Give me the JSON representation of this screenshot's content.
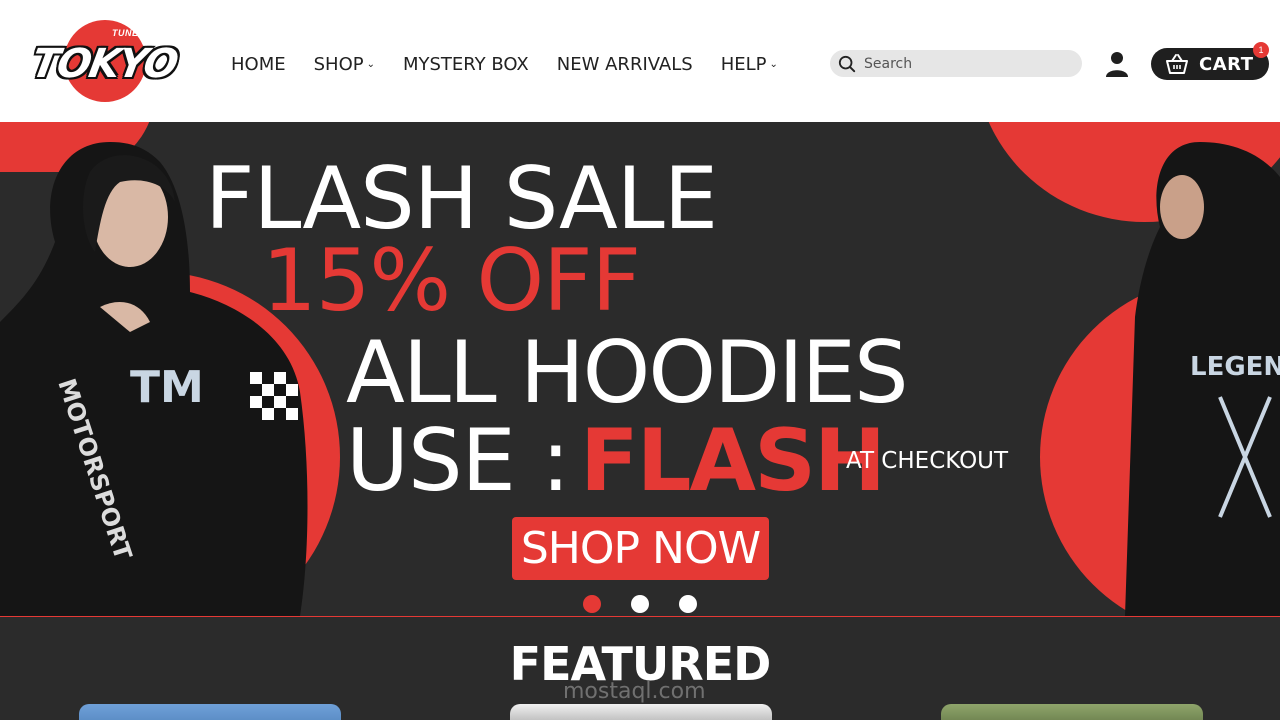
{
  "header": {
    "logo": {
      "text": "TOKYO",
      "tagline": "TUNED IN"
    },
    "nav": [
      {
        "label": "HOME",
        "has_dropdown": false
      },
      {
        "label": "SHOP",
        "has_dropdown": true
      },
      {
        "label": "MYSTERY BOX",
        "has_dropdown": false
      },
      {
        "label": "NEW ARRIVALS",
        "has_dropdown": false
      },
      {
        "label": "HELP",
        "has_dropdown": true
      }
    ],
    "search": {
      "placeholder": "Search",
      "value": ""
    },
    "cart": {
      "label": "CART",
      "count": "1"
    }
  },
  "hero": {
    "line1": "FLASH SALE",
    "line2": "15% OFF",
    "line3": "ALL HOODIES",
    "line4_prefix": "USE :",
    "code": "FLASH",
    "line4_suffix": "AT CHECKOUT",
    "cta": "SHOP NOW",
    "slides": 3,
    "active_slide": 1,
    "sleeve_text_left": "MOTORSPORT",
    "chest_text_left": "TM",
    "back_text_right": "LEGEND"
  },
  "featured": {
    "title": "FEATURED",
    "watermark": "mostaql.com"
  },
  "colors": {
    "accent": "#e53935",
    "hero_bg": "#2b2b2b",
    "text_dark": "#222222"
  }
}
